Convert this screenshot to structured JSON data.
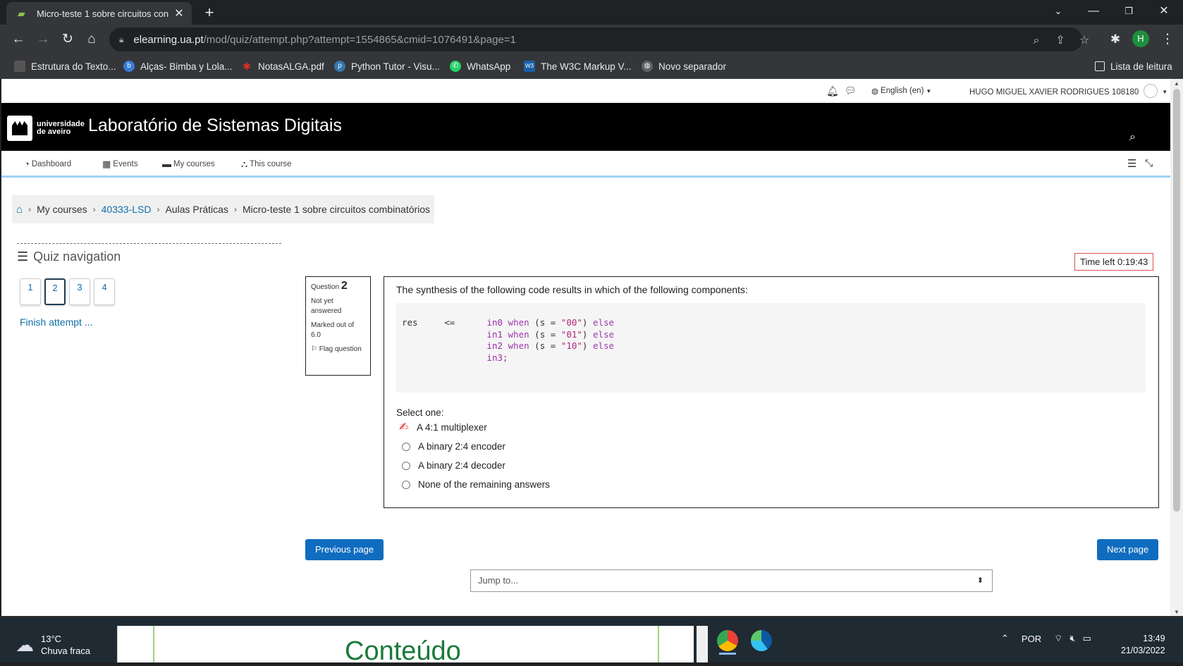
{
  "browser": {
    "tab_title": "Micro-teste 1 sobre circuitos con",
    "url_host": "elearning.ua.pt",
    "url_path": "/mod/quiz/attempt.php?attempt=1554865&cmid=1076491&page=1",
    "profile_initial": "H",
    "bookmarks": [
      {
        "label": "Estrutura do Texto...",
        "icon": "doc-icon",
        "color": "#4a4a4a"
      },
      {
        "label": "Alças- Bimba y Lola...",
        "icon": "bimba-icon",
        "color": "#3a7bd5"
      },
      {
        "label": "NotasALGA.pdf",
        "icon": "pdf-icon",
        "color": "#d93025"
      },
      {
        "label": "Python Tutor - Visu...",
        "icon": "python-icon",
        "color": "#3776ab"
      },
      {
        "label": "WhatsApp",
        "icon": "whatsapp-icon",
        "color": "#25d366"
      },
      {
        "label": "The W3C Markup V...",
        "icon": "w3c-icon",
        "color": "#1a5fa8"
      },
      {
        "label": "Novo separador",
        "icon": "globe-icon",
        "color": "#5f6368"
      }
    ],
    "reading_list": "Lista de leitura"
  },
  "site": {
    "language": "English (en)",
    "user_name": "HUGO MIGUEL XAVIER RODRIGUES 108180",
    "university": [
      "universidade",
      "de aveiro"
    ],
    "title": "Laboratório de Sistemas Digitais",
    "nav": [
      "Dashboard",
      "Events",
      "My courses",
      "This course"
    ]
  },
  "breadcrumb": {
    "items": [
      "My courses",
      "40333-LSD",
      "Aulas Práticas",
      "Micro-teste 1 sobre circuitos combinatórios"
    ]
  },
  "quiz_nav": {
    "title": "Quiz navigation",
    "questions": [
      "1",
      "2",
      "3",
      "4"
    ],
    "current": "2",
    "finish": "Finish attempt ..."
  },
  "timer": "Time left 0:19:43",
  "question_info": {
    "label": "Question",
    "number": "2",
    "status": "Not yet answered",
    "marks": "Marked out of 6.0",
    "flag": "Flag question"
  },
  "question": {
    "text": "The synthesis of the following code results in which of the following components:",
    "code": {
      "target": "res",
      "op": "<=",
      "lines": [
        {
          "in": "in0",
          "when": "when",
          "cond_pre": " (s = ",
          "val": "\"00\"",
          "cond_post": ") ",
          "else": "else"
        },
        {
          "in": "in1",
          "when": "when",
          "cond_pre": " (s = ",
          "val": "\"01\"",
          "cond_post": ") ",
          "else": "else"
        },
        {
          "in": "in2",
          "when": "when",
          "cond_pre": " (s = ",
          "val": "\"10\"",
          "cond_post": ") ",
          "else": "else"
        }
      ],
      "last": "in3;"
    },
    "select_label": "Select one:",
    "answers": [
      "A 4:1 multiplexer",
      "A binary 2:4 encoder",
      "A binary 2:4 decoder",
      "None of the remaining answers"
    ]
  },
  "buttons": {
    "previous": "Previous page",
    "next": "Next page",
    "jump_placeholder": "Jump to..."
  },
  "taskbar": {
    "temperature": "13°C",
    "weather": "Chuva fraca",
    "preview_word": "Conteúdo",
    "language": "POR",
    "time": "13:49",
    "date": "21/03/2022"
  },
  "colors": {
    "accent": "#0f6cbf",
    "link": "#0f6fa8",
    "header_bg": "#000000",
    "timer_border": "#d9534f"
  }
}
